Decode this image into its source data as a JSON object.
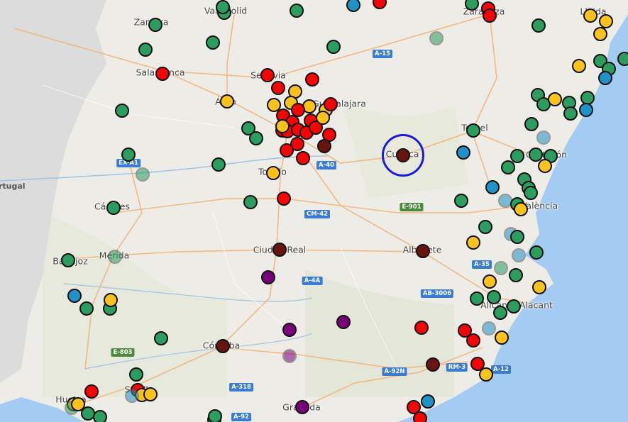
{
  "map": {
    "country_label": "rtugal",
    "highlight_marker": "Cuenca",
    "colors": {
      "green": "#2a9d5f",
      "red": "#ff0000",
      "yellow": "#ffc21a",
      "darkred": "#6a1410",
      "purple": "#7a007a",
      "blue": "#1f92c8",
      "sea": "#a4cbf2",
      "highlight": "#1a1ae0"
    }
  },
  "cities": [
    {
      "name": "Zamora"
    },
    {
      "name": "Valladolid"
    },
    {
      "name": "Zaragoza"
    },
    {
      "name": "Lleida"
    },
    {
      "name": "Salamanca"
    },
    {
      "name": "Segovia"
    },
    {
      "name": "Ávila"
    },
    {
      "name": "Guadalajara"
    },
    {
      "name": "Teruel"
    },
    {
      "name": "Castellón de la Plana"
    },
    {
      "name": "Valencia"
    },
    {
      "name": "Toledo"
    },
    {
      "name": "Cuenca"
    },
    {
      "name": "Cáceres"
    },
    {
      "name": "Mérida"
    },
    {
      "name": "Badajoz"
    },
    {
      "name": "Ciudad Real"
    },
    {
      "name": "Albacete"
    },
    {
      "name": "Alicante/Alacant"
    },
    {
      "name": "Córdoba"
    },
    {
      "name": "Granada"
    },
    {
      "name": "Huelva"
    },
    {
      "name": "Sevilla"
    }
  ],
  "labels": {
    "zamora": "Zamora",
    "valladolid": "Valladolid",
    "zaragoza": "Zaragoza",
    "lleida": "Lleida",
    "salamanca": "Salamanca",
    "segovia": "Segovia",
    "avila": "Ávila",
    "guadalajara": "Guadalajara",
    "teruel": "Teruel",
    "castellon": "Castellón",
    "valencia": "València",
    "toledo": "Toledo",
    "cuenca": "Cuenca",
    "caceres": "Cáceres",
    "merida": "Mérida",
    "badajoz": "Badajoz",
    "ciudadreal": "Ciudad Real",
    "albacete": "Albacete",
    "alicante": "Alicante/Alacant",
    "cordoba": "Córdoba",
    "granada": "Granada",
    "huelva": "Huelva",
    "sevilla": "Sevilla"
  },
  "roads": {
    "a15": "A-15",
    "a40": "A-40",
    "ca1": "EX-A1",
    "cm42": "CM-42",
    "e901": "E-901",
    "a4a": "A-4A",
    "a35": "A-35",
    "ab3006": "AB-3006",
    "e803": "E-803",
    "a318": "A-318",
    "a92n": "A-92N",
    "rm3": "RM-3",
    "a92": "A-92",
    "a12": "A-12"
  }
}
